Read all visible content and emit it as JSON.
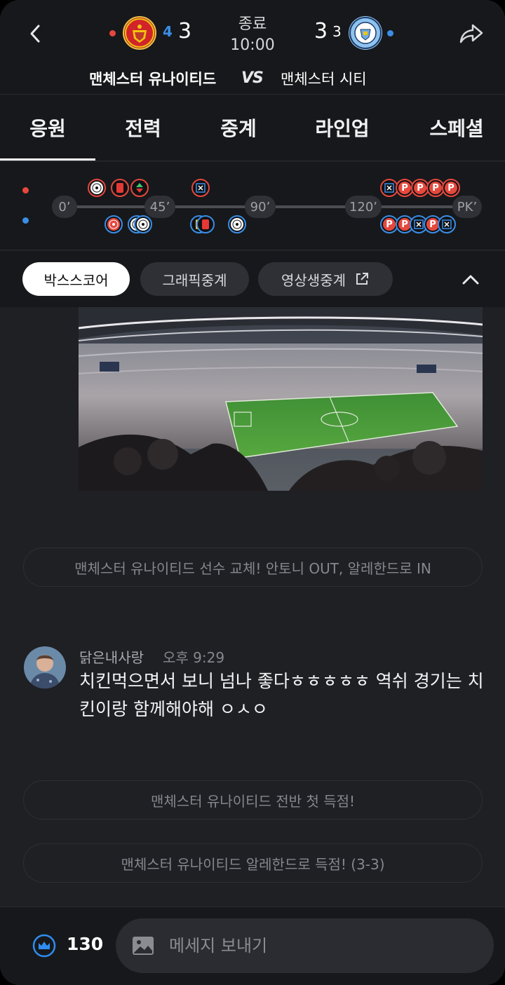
{
  "header": {
    "status": "종료",
    "time": "10:00",
    "vs": "VS",
    "home": {
      "name": "맨체스터 유나이티드",
      "crest_text": "MANCHESTER UNITED",
      "score_small": "4",
      "score": "3",
      "color": "#e5483d"
    },
    "away": {
      "name": "맨체스터 시티",
      "crest_text": "MANCHESTER CITY",
      "score": "3",
      "score_small": "3",
      "color": "#3a8ee6"
    }
  },
  "tabs": [
    {
      "label": "응원",
      "active": true
    },
    {
      "label": "전력",
      "active": false
    },
    {
      "label": "중계",
      "active": false
    },
    {
      "label": "라인업",
      "active": false
    },
    {
      "label": "스페셜",
      "active": false
    }
  ],
  "timeline": {
    "markers": [
      "0’",
      "45’",
      "90’",
      "120’",
      "PK’"
    ],
    "home_events": [
      "goal",
      "red-card",
      "substitution",
      "own-goal",
      "pk-miss",
      "pk-goal",
      "pk-goal",
      "pk-goal",
      "pk-goal"
    ],
    "away_events": [
      "goal",
      "goal",
      "goal",
      "yellow-card",
      "goal",
      "pk-goal",
      "pk-goal",
      "pk-miss",
      "pk-goal",
      "pk-miss"
    ],
    "pk_letter": "P"
  },
  "filters": {
    "chips": [
      {
        "label": "박스스코어",
        "active": true
      },
      {
        "label": "그래픽중계",
        "active": false
      },
      {
        "label": "영상생중계",
        "active": false
      }
    ]
  },
  "feed": {
    "system_messages": [
      "맨체스터 유나이티드 선수 교체! 안토니 OUT, 알레한드로 IN",
      "맨체스터 유나이티드 전반 첫 득점!",
      "맨체스터 유나이티드 알레한드로 득점! (3-3)"
    ],
    "chat": {
      "user": "닭은내사랑",
      "time": "오후 9:29",
      "text": "치킨먹으면서 보니 넘나 좋다ㅎㅎㅎㅎㅎ 역쉬 경기는 치킨이랑 함께해야해 ㅇㅅㅇ"
    }
  },
  "bottom": {
    "count": "130",
    "input_placeholder": "메세지 보내기"
  }
}
